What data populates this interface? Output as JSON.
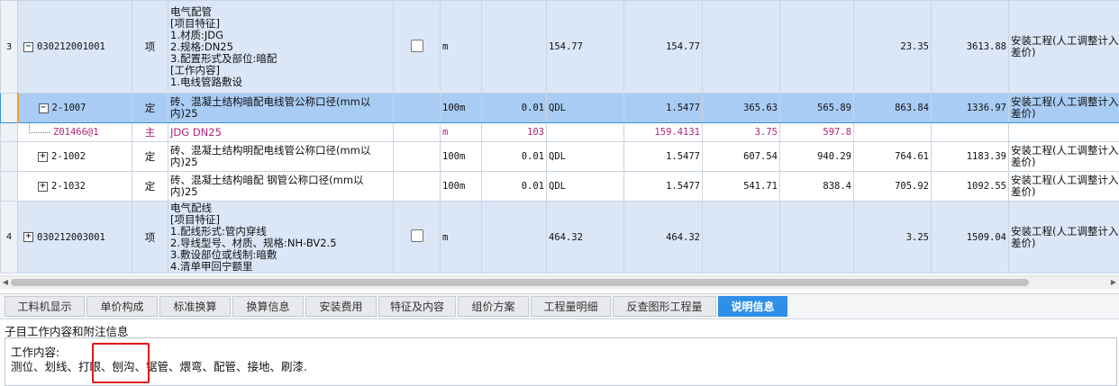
{
  "rows": [
    {
      "kind": "qd",
      "row_no": "3",
      "expand": "−",
      "code": "030212001001",
      "type": "项",
      "desc_lines": [
        "电气配管",
        "[项目特征]",
        "1.材质:JDG",
        "2.规格:DN25",
        "3.配置形式及部位:暗配",
        "[工作内容]",
        "1.电线管路敷设"
      ],
      "checkbox": true,
      "unit": "m",
      "qty": "",
      "expr": "154.77",
      "qty2": "154.77",
      "c1": "",
      "c2": "",
      "c3": "23.35",
      "c4": "3613.88",
      "prof": "安装工程(人工调整计入差价)",
      "last": "安"
    },
    {
      "kind": "sel",
      "row_no": "",
      "expand": "−",
      "code": "2-1007",
      "type": "定",
      "desc_lines": [
        "砖、混凝土结构暗配电线管公称口径(mm以内)25"
      ],
      "checkbox": false,
      "unit": "100m",
      "qty": "0.01",
      "expr": "QDL",
      "qty2": "1.5477",
      "c1": "365.63",
      "c2": "565.89",
      "c3": "863.84",
      "c4": "1336.97",
      "prof": "安装工程(人工调整计入差价)",
      "last": "安"
    },
    {
      "kind": "main",
      "row_no": "",
      "expand": "",
      "code": "Z01466@1",
      "type": "主",
      "desc_lines": [
        "JDG DN25"
      ],
      "checkbox": false,
      "unit": "m",
      "qty": "103",
      "expr": "",
      "qty2": "159.4131",
      "c1": "3.75",
      "c2": "597.8",
      "c3": "",
      "c4": "",
      "prof": "",
      "last": ""
    },
    {
      "kind": "de",
      "row_no": "",
      "expand": "+",
      "code": "2-1002",
      "type": "定",
      "desc_lines": [
        "砖、混凝土结构明配电线管公称口径(mm以内)25"
      ],
      "checkbox": false,
      "unit": "100m",
      "qty": "0.01",
      "expr": "QDL",
      "qty2": "1.5477",
      "c1": "607.54",
      "c2": "940.29",
      "c3": "764.61",
      "c4": "1183.39",
      "prof": "安装工程(人工调整计入差价)",
      "last": "安"
    },
    {
      "kind": "de",
      "row_no": "",
      "expand": "+",
      "code": "2-1032",
      "type": "定",
      "desc_lines": [
        "砖、混凝土结构暗配 钢管公称口径(mm以内)25"
      ],
      "checkbox": false,
      "unit": "100m",
      "qty": "0.01",
      "expr": "QDL",
      "qty2": "1.5477",
      "c1": "541.71",
      "c2": "838.4",
      "c3": "705.92",
      "c4": "1092.55",
      "prof": "安装工程(人工调整计入差价)",
      "last": "安"
    },
    {
      "kind": "qd",
      "row_no": "4",
      "expand": "+",
      "code": "030212003001",
      "type": "项",
      "desc_lines": [
        "电气配线",
        "[项目特征]",
        "1.配线形式:管内穿线",
        "2.导线型号、材质、规格:NH-BV2.5",
        "3.敷设部位或线制:暗敷",
        "4.清单甲回宁额里"
      ],
      "checkbox": true,
      "unit": "m",
      "qty": "",
      "expr": "464.32",
      "qty2": "464.32",
      "c1": "",
      "c2": "",
      "c3": "3.25",
      "c4": "1509.04",
      "prof": "安装工程(人工调整计入差价)",
      "last": "安"
    }
  ],
  "tabs": [
    "工料机显示",
    "单价构成",
    "标准换算",
    "换算信息",
    "安装费用",
    "特征及内容",
    "组价方案",
    "工程量明细",
    "反查图形工程量",
    "说明信息"
  ],
  "active_tab": "说明信息",
  "panel": {
    "title": "子目工作内容和附注信息",
    "line1": "工作内容:",
    "line2": "测位、划线、打眼、刨沟、锯管、煨弯、配管、接地、刷漆."
  }
}
